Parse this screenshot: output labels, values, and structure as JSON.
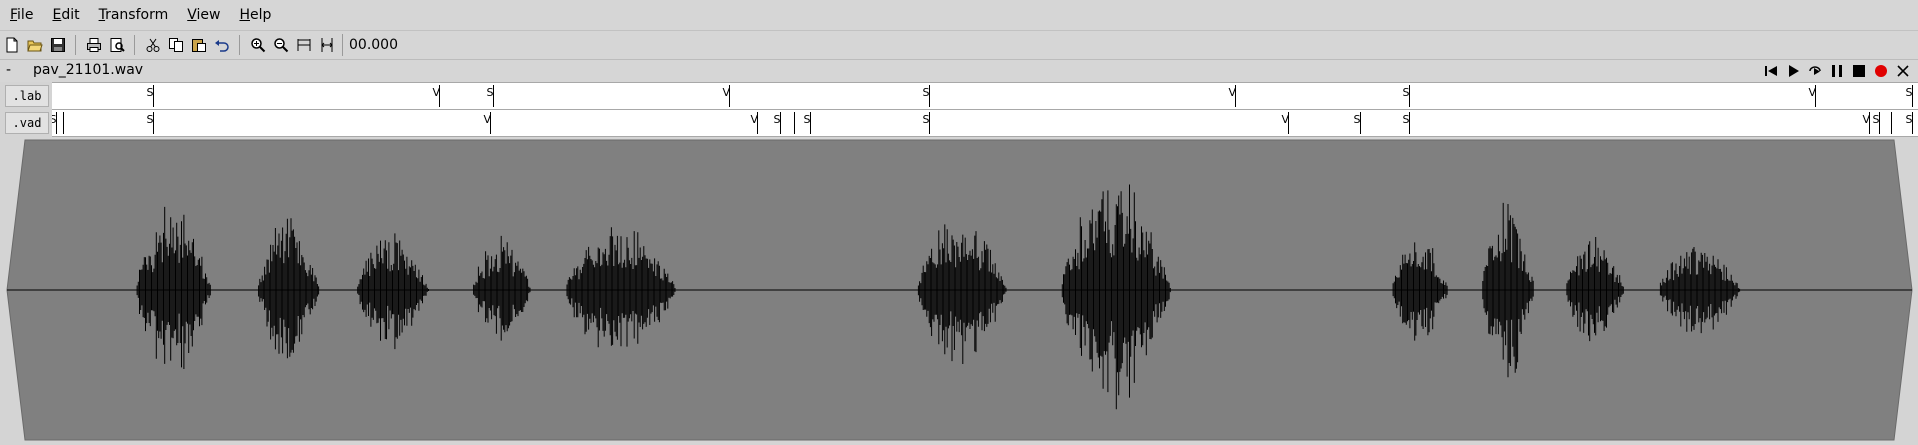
{
  "menu": [
    {
      "label": "File",
      "accel": "F"
    },
    {
      "label": "Edit",
      "accel": "E"
    },
    {
      "label": "Transform",
      "accel": "T"
    },
    {
      "label": "View",
      "accel": "V"
    },
    {
      "label": "Help",
      "accel": "H"
    }
  ],
  "toolbar": {
    "time_display": "00.000",
    "icons": [
      "new-file-icon",
      "open-folder-icon",
      "save-icon",
      "print-icon",
      "print-preview-icon",
      "cut-icon",
      "copy-icon",
      "paste-icon",
      "undo-icon",
      "zoom-in-icon",
      "zoom-out-icon",
      "zoom-fit-icon",
      "zoom-selection-icon"
    ]
  },
  "title_row": {
    "dash": "-",
    "file_name": "pav_21101.wav",
    "transport_icons": [
      "skip-to-start-icon",
      "play-icon",
      "loop-play-icon",
      "pause-icon",
      "stop-icon",
      "record-icon",
      "close-icon"
    ]
  },
  "tiers": [
    {
      "name": ".lab",
      "marks": [
        {
          "pos": 0.0543,
          "label": "S"
        },
        {
          "pos": 0.2072,
          "label": "V"
        },
        {
          "pos": 0.2365,
          "label": "S"
        },
        {
          "pos": 0.3628,
          "label": "V"
        },
        {
          "pos": 0.4698,
          "label": "S"
        },
        {
          "pos": 0.6342,
          "label": "V"
        },
        {
          "pos": 0.7273,
          "label": "S"
        },
        {
          "pos": 0.9449,
          "label": "V"
        },
        {
          "pos": 0.9968,
          "label": "S"
        }
      ]
    },
    {
      "name": ".vad",
      "marks": [
        {
          "pos": 0.0023,
          "label": "S"
        },
        {
          "pos": 0.006,
          "label": ""
        },
        {
          "pos": 0.0543,
          "label": "S"
        },
        {
          "pos": 0.2345,
          "label": "V"
        },
        {
          "pos": 0.378,
          "label": "V"
        },
        {
          "pos": 0.39,
          "label": "S"
        },
        {
          "pos": 0.3977,
          "label": ""
        },
        {
          "pos": 0.406,
          "label": "S"
        },
        {
          "pos": 0.4698,
          "label": "S"
        },
        {
          "pos": 0.6622,
          "label": "V"
        },
        {
          "pos": 0.7012,
          "label": "S"
        },
        {
          "pos": 0.7273,
          "label": "S"
        },
        {
          "pos": 0.9737,
          "label": "V"
        },
        {
          "pos": 0.979,
          "label": "S"
        },
        {
          "pos": 0.9855,
          "label": ""
        },
        {
          "pos": 0.9968,
          "label": "S"
        }
      ]
    }
  ],
  "waveform": {
    "background": "#808080",
    "trace_color": "#000000",
    "segments": [
      {
        "start": 0.06,
        "end": 0.125,
        "peak": 0.62
      },
      {
        "start": 0.125,
        "end": 0.178,
        "peak": 0.55
      },
      {
        "start": 0.178,
        "end": 0.24,
        "peak": 0.42
      },
      {
        "start": 0.24,
        "end": 0.29,
        "peak": 0.4
      },
      {
        "start": 0.29,
        "end": 0.385,
        "peak": 0.48
      },
      {
        "start": 0.478,
        "end": 0.555,
        "peak": 0.55
      },
      {
        "start": 0.555,
        "end": 0.65,
        "peak": 0.8
      },
      {
        "start": 0.732,
        "end": 0.78,
        "peak": 0.42
      },
      {
        "start": 0.78,
        "end": 0.825,
        "peak": 0.68
      },
      {
        "start": 0.825,
        "end": 0.875,
        "peak": 0.4
      },
      {
        "start": 0.875,
        "end": 0.945,
        "peak": 0.35
      }
    ]
  }
}
